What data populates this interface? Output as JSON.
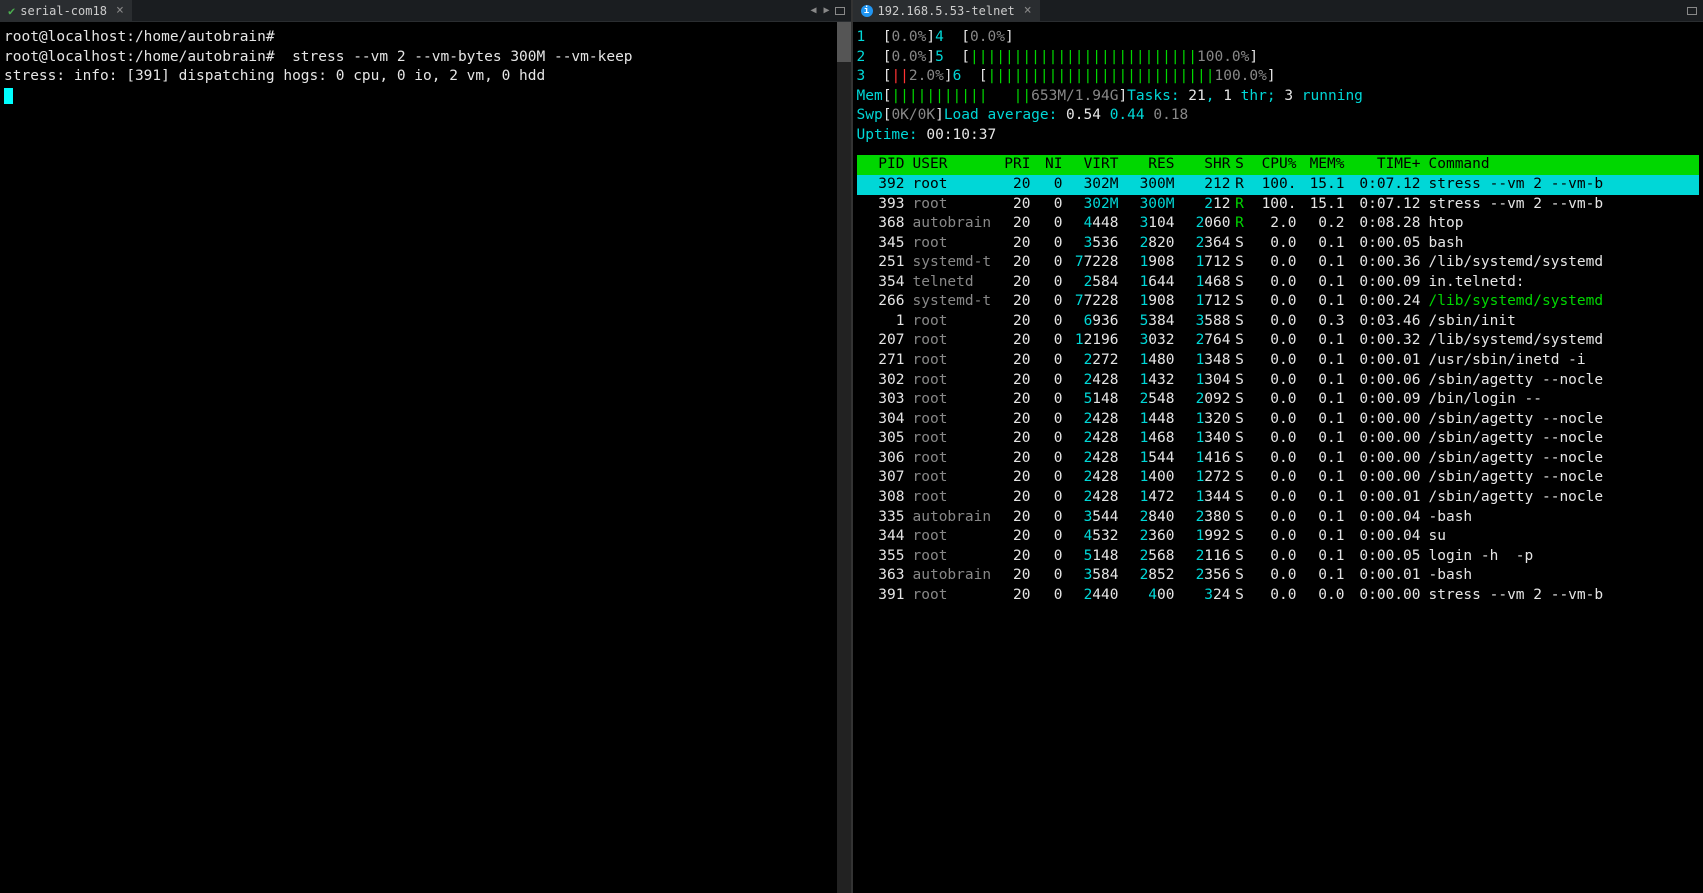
{
  "left": {
    "tab": {
      "title": "serial-com18"
    },
    "prompt1": "root@localhost:/home/autobrain#",
    "prompt2": "root@localhost:/home/autobrain#  stress --vm 2 --vm-bytes 300M --vm-keep",
    "output1": "stress: info: [391] dispatching hogs: 0 cpu, 0 io, 2 vm, 0 hdd"
  },
  "right": {
    "tab": {
      "title": "192.168.5.53-telnet"
    },
    "cpus": [
      {
        "id": "1",
        "fill": "",
        "pct": "0.0%"
      },
      {
        "id": "2",
        "fill": "",
        "pct": "0.0%"
      },
      {
        "id": "3",
        "fill": "||",
        "pct": "2.0%",
        "red": true
      },
      {
        "id": "4",
        "fill": "",
        "pct": "0.0%"
      },
      {
        "id": "5",
        "fill": "||||||||||||||||||||||||||",
        "pct": "100.0%"
      },
      {
        "id": "6",
        "fill": "||||||||||||||||||||||||||",
        "pct": "100.0%"
      }
    ],
    "mem": {
      "label": "Mem",
      "fill": "|||||||||||   ||",
      "value": "653M/1.94G"
    },
    "swp": {
      "label": "Swp",
      "fill": "",
      "value": "0K/0K"
    },
    "tasks": {
      "label": "Tasks: ",
      "total": "21",
      "sep1": ", ",
      "thr": "1",
      "thr_lbl": " thr; ",
      "running": "3",
      "run_lbl": " running"
    },
    "load": {
      "label": "Load average: ",
      "l1": "0.54",
      "l2": "0.44",
      "l3": "0.18"
    },
    "uptime": {
      "label": "Uptime: ",
      "value": "00:10:37"
    },
    "header": {
      "pid": "PID",
      "user": "USER",
      "pri": "PRI",
      "ni": "NI",
      "virt": "VIRT",
      "res": "RES",
      "shr": "SHR",
      "s": "S",
      "cpu": "CPU%",
      "mem": "MEM%",
      "time": "TIME+",
      "cmd": "Command"
    },
    "processes": [
      {
        "pid": "392",
        "user": "root",
        "pri": "20",
        "ni": "0",
        "virt": "302M",
        "res": "300M",
        "shr": "212",
        "s": "R",
        "cpu": "100.",
        "mem": "15.1",
        "time": "0:07.12",
        "cmd": "stress --vm 2 --vm-b",
        "selected": true
      },
      {
        "pid": "393",
        "user": "root",
        "pri": "20",
        "ni": "0",
        "virt": "302M",
        "res": "300M",
        "shr": "212",
        "s": "R",
        "cpu": "100.",
        "mem": "15.1",
        "time": "0:07.12",
        "cmd": "stress --vm 2 --vm-b",
        "srun": true
      },
      {
        "pid": "368",
        "user": "autobrain",
        "pri": "20",
        "ni": "0",
        "virt": "4448",
        "res": "3104",
        "shr": "2060",
        "s": "R",
        "cpu": "2.0",
        "mem": "0.2",
        "time": "0:08.28",
        "cmd": "htop",
        "srun": true
      },
      {
        "pid": "345",
        "user": "root",
        "pri": "20",
        "ni": "0",
        "virt": "3536",
        "res": "2820",
        "shr": "2364",
        "s": "S",
        "cpu": "0.0",
        "mem": "0.1",
        "time": "0:00.05",
        "cmd": "bash"
      },
      {
        "pid": "251",
        "user": "systemd-t",
        "pri": "20",
        "ni": "0",
        "virt": "77228",
        "res": "1908",
        "shr": "1712",
        "s": "S",
        "cpu": "0.0",
        "mem": "0.1",
        "time": "0:00.36",
        "cmd": "/lib/systemd/systemd"
      },
      {
        "pid": "354",
        "user": "telnetd",
        "pri": "20",
        "ni": "0",
        "virt": "2584",
        "res": "1644",
        "shr": "1468",
        "s": "S",
        "cpu": "0.0",
        "mem": "0.1",
        "time": "0:00.09",
        "cmd": "in.telnetd:"
      },
      {
        "pid": "266",
        "user": "systemd-t",
        "pri": "20",
        "ni": "0",
        "virt": "77228",
        "res": "1908",
        "shr": "1712",
        "s": "S",
        "cpu": "0.0",
        "mem": "0.1",
        "time": "0:00.24",
        "cmd": "/lib/systemd/systemd",
        "cmdgreen": true
      },
      {
        "pid": "1",
        "user": "root",
        "pri": "20",
        "ni": "0",
        "virt": "6936",
        "res": "5384",
        "shr": "3588",
        "s": "S",
        "cpu": "0.0",
        "mem": "0.3",
        "time": "0:03.46",
        "cmd": "/sbin/init"
      },
      {
        "pid": "207",
        "user": "root",
        "pri": "20",
        "ni": "0",
        "virt": "12196",
        "res": "3032",
        "shr": "2764",
        "s": "S",
        "cpu": "0.0",
        "mem": "0.1",
        "time": "0:00.32",
        "cmd": "/lib/systemd/systemd"
      },
      {
        "pid": "271",
        "user": "root",
        "pri": "20",
        "ni": "0",
        "virt": "2272",
        "res": "1480",
        "shr": "1348",
        "s": "S",
        "cpu": "0.0",
        "mem": "0.1",
        "time": "0:00.01",
        "cmd": "/usr/sbin/inetd -i"
      },
      {
        "pid": "302",
        "user": "root",
        "pri": "20",
        "ni": "0",
        "virt": "2428",
        "res": "1432",
        "shr": "1304",
        "s": "S",
        "cpu": "0.0",
        "mem": "0.1",
        "time": "0:00.06",
        "cmd": "/sbin/agetty --nocle"
      },
      {
        "pid": "303",
        "user": "root",
        "pri": "20",
        "ni": "0",
        "virt": "5148",
        "res": "2548",
        "shr": "2092",
        "s": "S",
        "cpu": "0.0",
        "mem": "0.1",
        "time": "0:00.09",
        "cmd": "/bin/login --"
      },
      {
        "pid": "304",
        "user": "root",
        "pri": "20",
        "ni": "0",
        "virt": "2428",
        "res": "1448",
        "shr": "1320",
        "s": "S",
        "cpu": "0.0",
        "mem": "0.1",
        "time": "0:00.00",
        "cmd": "/sbin/agetty --nocle"
      },
      {
        "pid": "305",
        "user": "root",
        "pri": "20",
        "ni": "0",
        "virt": "2428",
        "res": "1468",
        "shr": "1340",
        "s": "S",
        "cpu": "0.0",
        "mem": "0.1",
        "time": "0:00.00",
        "cmd": "/sbin/agetty --nocle"
      },
      {
        "pid": "306",
        "user": "root",
        "pri": "20",
        "ni": "0",
        "virt": "2428",
        "res": "1544",
        "shr": "1416",
        "s": "S",
        "cpu": "0.0",
        "mem": "0.1",
        "time": "0:00.00",
        "cmd": "/sbin/agetty --nocle"
      },
      {
        "pid": "307",
        "user": "root",
        "pri": "20",
        "ni": "0",
        "virt": "2428",
        "res": "1400",
        "shr": "1272",
        "s": "S",
        "cpu": "0.0",
        "mem": "0.1",
        "time": "0:00.00",
        "cmd": "/sbin/agetty --nocle"
      },
      {
        "pid": "308",
        "user": "root",
        "pri": "20",
        "ni": "0",
        "virt": "2428",
        "res": "1472",
        "shr": "1344",
        "s": "S",
        "cpu": "0.0",
        "mem": "0.1",
        "time": "0:00.01",
        "cmd": "/sbin/agetty --nocle"
      },
      {
        "pid": "335",
        "user": "autobrain",
        "pri": "20",
        "ni": "0",
        "virt": "3544",
        "res": "2840",
        "shr": "2380",
        "s": "S",
        "cpu": "0.0",
        "mem": "0.1",
        "time": "0:00.04",
        "cmd": "-bash"
      },
      {
        "pid": "344",
        "user": "root",
        "pri": "20",
        "ni": "0",
        "virt": "4532",
        "res": "2360",
        "shr": "1992",
        "s": "S",
        "cpu": "0.0",
        "mem": "0.1",
        "time": "0:00.04",
        "cmd": "su"
      },
      {
        "pid": "355",
        "user": "root",
        "pri": "20",
        "ni": "0",
        "virt": "5148",
        "res": "2568",
        "shr": "2116",
        "s": "S",
        "cpu": "0.0",
        "mem": "0.1",
        "time": "0:00.05",
        "cmd": "login -h  -p"
      },
      {
        "pid": "363",
        "user": "autobrain",
        "pri": "20",
        "ni": "0",
        "virt": "3584",
        "res": "2852",
        "shr": "2356",
        "s": "S",
        "cpu": "0.0",
        "mem": "0.1",
        "time": "0:00.01",
        "cmd": "-bash"
      },
      {
        "pid": "391",
        "user": "root",
        "pri": "20",
        "ni": "0",
        "virt": "2440",
        "res": "400",
        "shr": "324",
        "s": "S",
        "cpu": "0.0",
        "mem": "0.0",
        "time": "0:00.00",
        "cmd": "stress --vm 2 --vm-b"
      }
    ]
  }
}
